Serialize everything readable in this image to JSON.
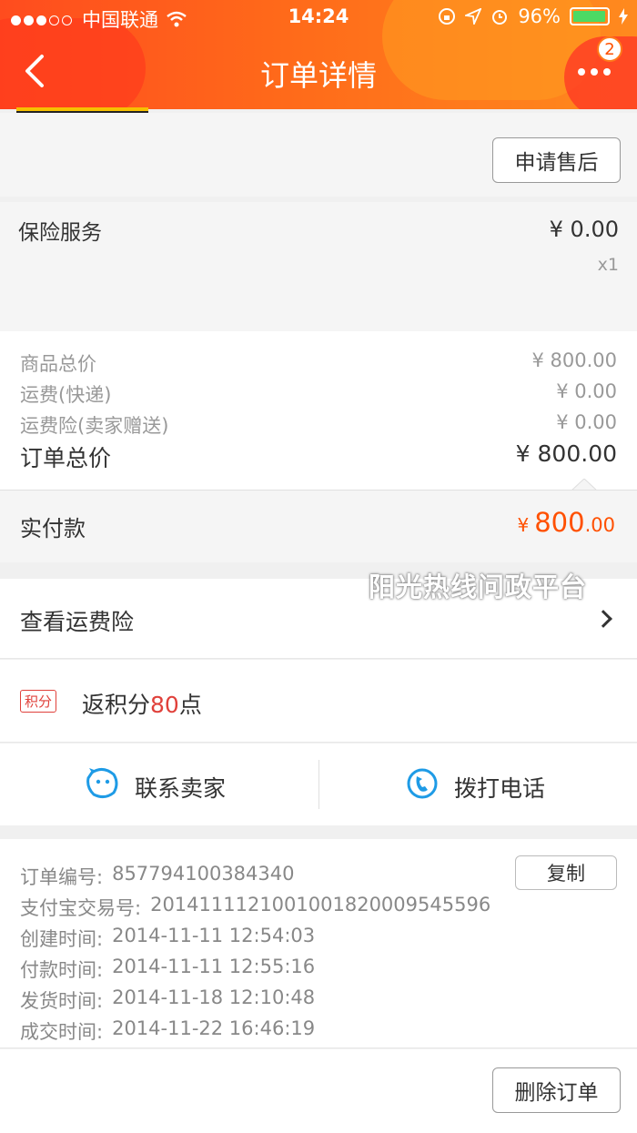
{
  "status_bar": {
    "carrier": "中国联通",
    "time": "14:24",
    "battery": "96%",
    "battery_level": 0.96
  },
  "nav": {
    "title": "订单详情",
    "badge_count": "2"
  },
  "after_sale_button": "申请售后",
  "insurance": {
    "label": "保险服务",
    "price": "¥ 0.00",
    "qty": "x1"
  },
  "price_summary": {
    "items": [
      {
        "label": "商品总价",
        "value": "¥ 800.00"
      },
      {
        "label": "运费(快递)",
        "value": "¥ 0.00"
      },
      {
        "label": "运费险(卖家赠送)",
        "value": "¥ 0.00"
      }
    ],
    "total_label": "订单总价",
    "total_value": "¥ 800.00"
  },
  "actual_payment": {
    "label": "实付款",
    "currency": "¥",
    "integer": "800",
    "decimal": ".00"
  },
  "watermark": "阳光热线问政平台",
  "shipping_insurance_link": "查看运费险",
  "points": {
    "tag": "积分",
    "prefix": "返积分",
    "value": "80",
    "suffix": "点"
  },
  "contact": {
    "seller": "联系卖家",
    "phone": "拨打电话"
  },
  "order_info": {
    "copy_button": "复制",
    "rows": [
      {
        "key": "订单编号:",
        "value": "857794100384340"
      },
      {
        "key": "支付宝交易号:",
        "value": "2014111121001001820009545596"
      },
      {
        "key": "创建时间:",
        "value": "2014-11-11 12:54:03"
      },
      {
        "key": "付款时间:",
        "value": "2014-11-11 12:55:16"
      },
      {
        "key": "发货时间:",
        "value": "2014-11-18 12:10:48"
      },
      {
        "key": "成交时间:",
        "value": "2014-11-22 16:46:19"
      }
    ]
  },
  "delete_button": "删除订单",
  "colors": {
    "accent": "#ff5000",
    "points_red": "#e0413b",
    "contact_blue": "#1e9be6"
  }
}
